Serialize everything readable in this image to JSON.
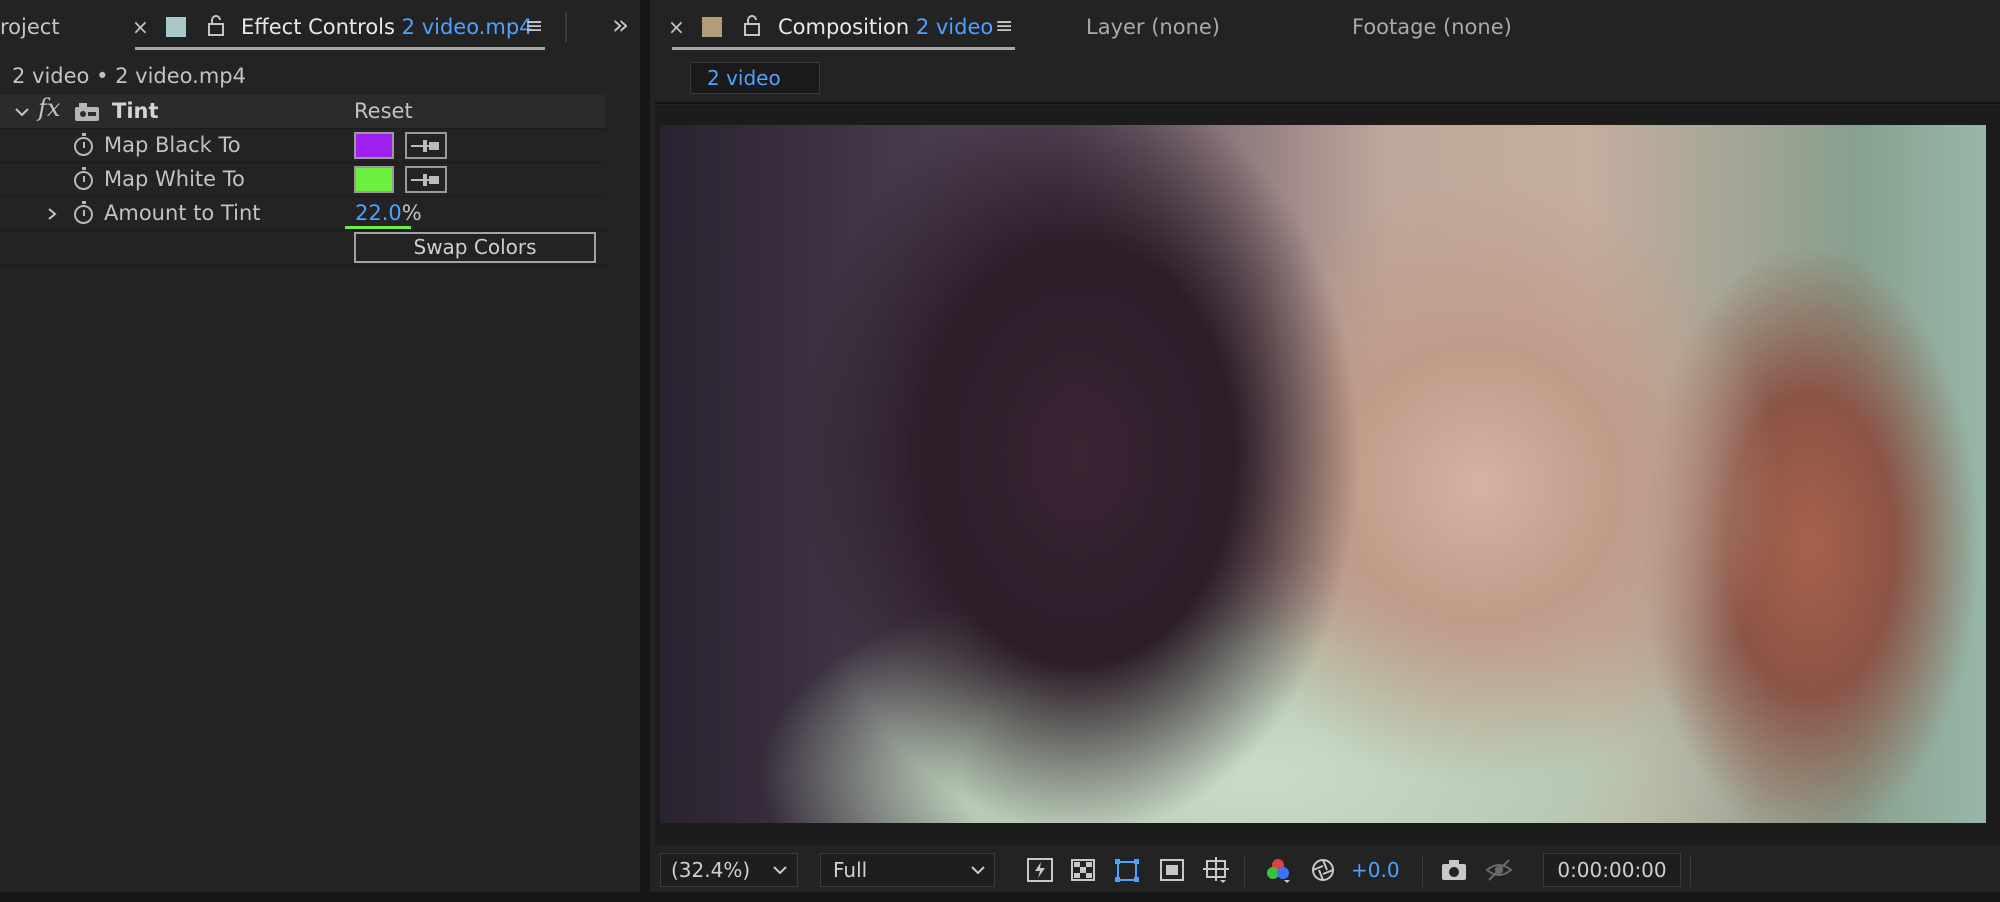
{
  "left_panel": {
    "tabs": {
      "project_label": "roject",
      "close_glyph": "×",
      "effect_controls_label": "Effect Controls",
      "effect_controls_target": "2 video.mp4",
      "menu_glyph": "≡",
      "overflow_glyph": "»"
    },
    "breadcrumb": "2 video • 2 video.mp4",
    "effect": {
      "fx_glyph": "fx",
      "name": "Tint",
      "reset_label": "Reset",
      "properties": {
        "map_black": {
          "label": "Map Black To",
          "color": "#a020f0"
        },
        "map_white": {
          "label": "Map White To",
          "color": "#6cf040"
        },
        "amount": {
          "label": "Amount to Tint",
          "value": "22.0",
          "unit": "%",
          "fraction": 0.22
        }
      },
      "swap_colors_label": "Swap Colors"
    }
  },
  "right_panel": {
    "tabs": {
      "close_glyph": "×",
      "composition_label": "Composition",
      "composition_name": "2 video",
      "menu_glyph": "≡",
      "layer_label": "Layer (none)",
      "footage_label": "Footage (none)"
    },
    "sub_tab": "2 video",
    "viewer_toolbar": {
      "zoom": "(32.4%)",
      "resolution": "Full",
      "exposure": "+0.0",
      "timecode": "0:00:00:00"
    }
  },
  "colors": {
    "accent_blue": "#4fa0ff",
    "panel_bg": "#232323",
    "ec_swatch_cyan": "#a9c8c9",
    "comp_swatch_tan": "#b39c7a",
    "slider_green": "#6cf040"
  },
  "icons": [
    "close-icon",
    "lock-icon",
    "menu-icon",
    "chevron-double-right-icon",
    "chevron-down-icon",
    "chevron-right-icon",
    "stopwatch-icon",
    "eyedropper-icon",
    "fast-preview-icon",
    "transparency-grid-icon",
    "region-of-interest-icon",
    "mask-toggle-icon",
    "guides-icon",
    "color-channels-icon",
    "exposure-reset-icon",
    "camera-icon",
    "show-snapshot-icon"
  ]
}
